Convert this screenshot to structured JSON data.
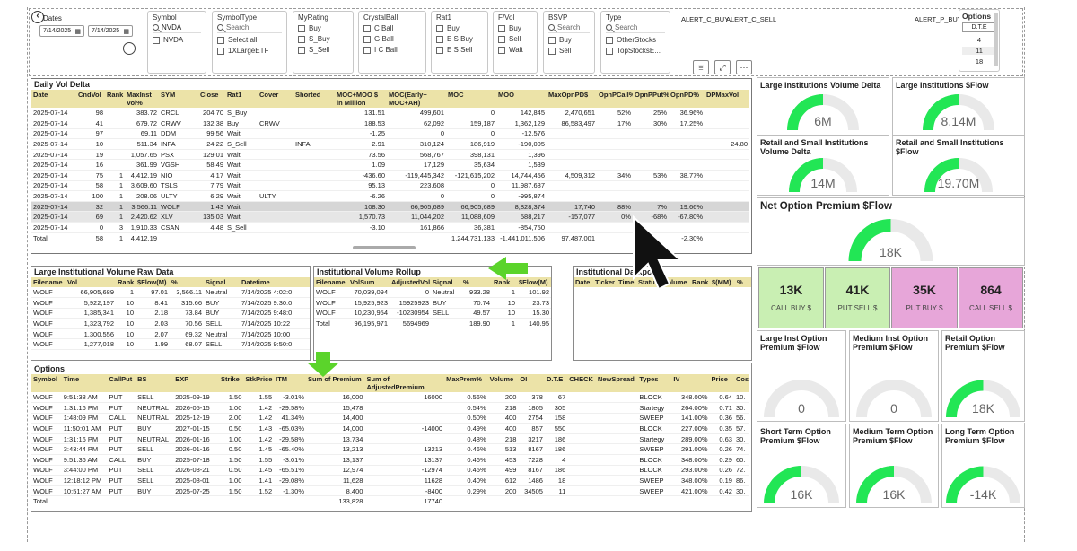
{
  "slicers": {
    "dates": {
      "title": "Dates",
      "start": "7/14/2025",
      "end": "7/14/2025"
    },
    "symbol": {
      "title": "Symbol",
      "search": "NVDA",
      "options": [
        "NVDA"
      ]
    },
    "symboltype": {
      "title": "SymbolType",
      "search": "Search",
      "options": [
        "Select all",
        "1XLargeETF"
      ]
    },
    "myrating": {
      "title": "MyRating",
      "options": [
        "Buy",
        "S_Buy",
        "S_Sell"
      ]
    },
    "crystalball": {
      "title": "CrystalBall",
      "options": [
        "C Ball",
        "G Ball",
        "I C Ball"
      ]
    },
    "rat1": {
      "title": "Rat1",
      "options": [
        "Buy",
        "E S Buy",
        "E S Sell"
      ]
    },
    "fvol": {
      "title": "F/Vol",
      "options": [
        "Buy",
        "Sell",
        "Wait"
      ]
    },
    "bsvp": {
      "title": "BSVP",
      "search": "Search",
      "options": [
        "Buy",
        "Sell"
      ]
    },
    "type": {
      "title": "Type",
      "search": "Search",
      "options": [
        "OtherStocks",
        "TopStocksE..."
      ]
    },
    "alerts": [
      "ALERT_C_BUY",
      "ALERT_C_SELL",
      "ALERT_P_BUY"
    ],
    "options": {
      "title": "Options",
      "header": "D.T.E",
      "values": [
        "4",
        "11",
        "18"
      ]
    }
  },
  "daily": {
    "title": "Daily Vol Delta",
    "columns": [
      "Date",
      "CndVol",
      "Rank",
      "MaxInst Vol%",
      "SYM",
      "Close",
      "Rat1",
      "Cover",
      "Shorted",
      "MOC+MOO $ in Million",
      "MOC(Early+ MOC+AH)",
      "MOC",
      "MOO",
      "MaxOpnPD$",
      "OpnPCall%",
      "OpnPPut%",
      "OpnPD%",
      "DPMaxVol"
    ],
    "rows": [
      [
        "2025-07-14",
        "98",
        "",
        "383.72",
        "CRCL",
        "204.70",
        "S_Buy",
        "",
        "",
        "131.51",
        "499,601",
        "0",
        "142,845",
        "2,470,651",
        "52%",
        "25%",
        "36.96%",
        ""
      ],
      [
        "2025-07-14",
        "41",
        "",
        "679.72",
        "CRWV",
        "132.38",
        "Buy",
        "CRWV",
        "",
        "188.53",
        "62,092",
        "159,187",
        "1,362,129",
        "86,583,497",
        "17%",
        "30%",
        "17.25%",
        ""
      ],
      [
        "2025-07-14",
        "97",
        "",
        "69.11",
        "DDM",
        "99.56",
        "Wait",
        "",
        "",
        "-1.25",
        "0",
        "0",
        "-12,576",
        "",
        "",
        "",
        "",
        ""
      ],
      [
        "2025-07-14",
        "10",
        "",
        "511.34",
        "INFA",
        "24.22",
        "S_Sell",
        "",
        "INFA",
        "2.91",
        "310,124",
        "186,919",
        "-190,005",
        "",
        "",
        "",
        "",
        "24.80"
      ],
      [
        "2025-07-14",
        "19",
        "",
        "1,057.65",
        "PSX",
        "129.01",
        "Wait",
        "",
        "",
        "73.56",
        "568,767",
        "398,131",
        "1,396",
        "",
        "",
        "",
        "",
        ""
      ],
      [
        "2025-07-14",
        "16",
        "",
        "361.99",
        "VGSH",
        "58.49",
        "Wait",
        "",
        "",
        "1.09",
        "17,129",
        "35,634",
        "1,539",
        "",
        "",
        "",
        "",
        ""
      ],
      [
        "2025-07-14",
        "75",
        "1",
        "4,412.19",
        "NIO",
        "4.17",
        "Wait",
        "",
        "",
        "-436.60",
        "-119,445,342",
        "-121,615,202",
        "14,744,456",
        "4,509,312",
        "34%",
        "53%",
        "38.77%",
        ""
      ],
      [
        "2025-07-14",
        "58",
        "1",
        "3,609.60",
        "TSLS",
        "7.79",
        "Wait",
        "",
        "",
        "95.13",
        "223,608",
        "0",
        "11,987,687",
        "",
        "",
        "",
        "",
        ""
      ],
      [
        "2025-07-14",
        "100",
        "1",
        "208.06",
        "ULTY",
        "6.29",
        "Wait",
        "ULTY",
        "",
        "-6.26",
        "0",
        "0",
        "-995,874",
        "",
        "",
        "",
        "",
        ""
      ],
      [
        "2025-07-14",
        "32",
        "1",
        "3,566.11",
        "WOLF",
        "1.43",
        "Wait",
        "",
        "",
        "108.30",
        "66,905,689",
        "66,905,689",
        "8,828,374",
        "17,740",
        "88%",
        "7%",
        "19.66%",
        ""
      ],
      [
        "2025-07-14",
        "69",
        "1",
        "2,420.62",
        "XLV",
        "135.03",
        "Wait",
        "",
        "",
        "1,570.73",
        "11,044,202",
        "11,088,609",
        "588,217",
        "-157,077",
        "0%",
        "-68%",
        "-67.80%",
        ""
      ],
      [
        "2025-07-14",
        "0",
        "3",
        "1,910.33",
        "CSAN",
        "4.48",
        "S_Sell",
        "",
        "",
        "-3.10",
        "161,866",
        "36,381",
        "-854,750",
        "",
        "",
        "",
        "",
        ""
      ]
    ],
    "total": [
      "Total",
      "58",
      "1",
      "4,412.19",
      "",
      "",
      "",
      "",
      "",
      "",
      "",
      "1,244,731,133",
      "-1,441,011,506",
      "97,487,001",
      "",
      "",
      "-2.30%",
      ""
    ]
  },
  "large_inst": {
    "title": "Large Institutional Volume Raw Data",
    "columns": [
      "Filename",
      "Vol",
      "Rank",
      "$Flow(M)",
      "%",
      "Signal",
      "Datetime"
    ],
    "rows": [
      [
        "WOLF",
        "66,905,689",
        "1",
        "97.01",
        "3,566.11",
        "Neutral",
        "7/14/2025 4:02:0"
      ],
      [
        "WOLF",
        "5,922,197",
        "10",
        "8.41",
        "315.66",
        "BUY",
        "7/14/2025 9:30:0"
      ],
      [
        "WOLF",
        "1,385,341",
        "10",
        "2.18",
        "73.84",
        "BUY",
        "7/14/2025 9:48:0"
      ],
      [
        "WOLF",
        "1,323,792",
        "10",
        "2.03",
        "70.56",
        "SELL",
        "7/14/2025 10:22"
      ],
      [
        "WOLF",
        "1,300,556",
        "10",
        "2.07",
        "69.32",
        "Neutral",
        "7/14/2025 10:00"
      ],
      [
        "WOLF",
        "1,277,018",
        "10",
        "1.99",
        "68.07",
        "SELL",
        "7/14/2025 9:50:0"
      ]
    ]
  },
  "rollup": {
    "title": "Institutional Volume Rollup",
    "columns": [
      "Filename",
      "VolSum",
      "AdjustedVol",
      "Signal",
      "%",
      "Rank",
      "$Flow(M)"
    ],
    "rows": [
      [
        "WOLF",
        "70,039,094",
        "0",
        "Neutral",
        "933.28",
        "1",
        "101.92"
      ],
      [
        "WOLF",
        "15,925,923",
        "15925923",
        "BUY",
        "70.74",
        "10",
        "23.73"
      ],
      [
        "WOLF",
        "10,230,954",
        "-10230954",
        "SELL",
        "49.57",
        "10",
        "15.30"
      ]
    ],
    "total": [
      "Total",
      "96,195,971",
      "5694969",
      "",
      "189.90",
      "1",
      "140.95"
    ]
  },
  "darkpool": {
    "title": "Institutional Darkpool",
    "columns": [
      "Date",
      "Ticker",
      "Time",
      "Status",
      "Volume",
      "Rank",
      "$(MM)",
      "%"
    ]
  },
  "options_table": {
    "title": "Options",
    "columns": [
      "Symbol",
      "Time",
      "CallPut",
      "BS",
      "EXP",
      "Strike",
      "StkPrice",
      "ITM",
      "Sum of Premium",
      "Sum of AdjustedPremium",
      "MaxPrem%",
      "Volume",
      "OI",
      "D.T.E",
      "CHECK",
      "NewSpread",
      "Types",
      "IV",
      "Price",
      "Cos"
    ],
    "rows": [
      [
        "WOLF",
        "9:51:38 AM",
        "PUT",
        "SELL",
        "2025-09-19",
        "1.50",
        "1.55",
        "-3.01%",
        "16,000",
        "16000",
        "0.56%",
        "200",
        "378",
        "67",
        "",
        "",
        "BLOCK",
        "348.00%",
        "0.64",
        "10."
      ],
      [
        "WOLF",
        "1:31:16 PM",
        "PUT",
        "NEUTRAL",
        "2026-05-15",
        "1.00",
        "1.42",
        "-29.58%",
        "15,478",
        "",
        "0.54%",
        "218",
        "1805",
        "305",
        "",
        "",
        "Startegy",
        "264.00%",
        "0.71",
        "30."
      ],
      [
        "WOLF",
        "1:48:09 PM",
        "CALL",
        "NEUTRAL",
        "2025-12-19",
        "2.00",
        "1.42",
        "41.34%",
        "14,400",
        "",
        "0.50%",
        "400",
        "2754",
        "158",
        "",
        "",
        "SWEEP",
        "141.00%",
        "0.36",
        "56."
      ],
      [
        "WOLF",
        "11:50:01 AM",
        "PUT",
        "BUY",
        "2027-01-15",
        "0.50",
        "1.43",
        "-65.03%",
        "14,000",
        "-14000",
        "0.49%",
        "400",
        "857",
        "550",
        "",
        "",
        "BLOCK",
        "227.00%",
        "0.35",
        "57."
      ],
      [
        "WOLF",
        "1:31:16 PM",
        "PUT",
        "NEUTRAL",
        "2026-01-16",
        "1.00",
        "1.42",
        "-29.58%",
        "13,734",
        "",
        "0.48%",
        "218",
        "3217",
        "186",
        "",
        "",
        "Startegy",
        "289.00%",
        "0.63",
        "30."
      ],
      [
        "WOLF",
        "3:43:44 PM",
        "PUT",
        "SELL",
        "2026-01-16",
        "0.50",
        "1.45",
        "-65.40%",
        "13,213",
        "13213",
        "0.46%",
        "513",
        "8167",
        "186",
        "",
        "",
        "SWEEP",
        "291.00%",
        "0.26",
        "74."
      ],
      [
        "WOLF",
        "9:51:36 AM",
        "CALL",
        "BUY",
        "2025-07-18",
        "1.50",
        "1.55",
        "-3.01%",
        "13,137",
        "13137",
        "0.46%",
        "453",
        "7228",
        "4",
        "",
        "",
        "BLOCK",
        "348.00%",
        "0.29",
        "60."
      ],
      [
        "WOLF",
        "3:44:00 PM",
        "PUT",
        "SELL",
        "2026-08-21",
        "0.50",
        "1.45",
        "-65.51%",
        "12,974",
        "-12974",
        "0.45%",
        "499",
        "8167",
        "186",
        "",
        "",
        "BLOCK",
        "293.00%",
        "0.26",
        "72."
      ],
      [
        "WOLF",
        "12:18:12 PM",
        "PUT",
        "SELL",
        "2025-08-01",
        "1.00",
        "1.41",
        "-29.08%",
        "11,628",
        "11628",
        "0.40%",
        "612",
        "1486",
        "18",
        "",
        "",
        "SWEEP",
        "348.00%",
        "0.19",
        "86."
      ],
      [
        "WOLF",
        "10:51:27 AM",
        "PUT",
        "BUY",
        "2025-07-25",
        "1.50",
        "1.52",
        "-1.30%",
        "8,400",
        "-8400",
        "0.29%",
        "200",
        "34505",
        "11",
        "",
        "",
        "SWEEP",
        "421.00%",
        "0.42",
        "30."
      ]
    ],
    "total": [
      "Total",
      "",
      "",
      "",
      "",
      "",
      "",
      "",
      "133,828",
      "17740",
      "",
      "",
      "",
      "",
      "",
      "",
      "",
      "",
      "",
      ""
    ]
  },
  "gauges": {
    "large_vol_delta": {
      "title": "Large Institutions Volume Delta",
      "value": "6M",
      "fraction": 0.5
    },
    "large_flow": {
      "title": "Large Institutions $Flow",
      "value": "8.14M",
      "fraction": 0.5
    },
    "retail_vol_delta": {
      "title": "Retail and Small Institutions Volume Delta",
      "value": "14M",
      "fraction": 0.5
    },
    "retail_flow": {
      "title": "Retail and Small Institutions $Flow",
      "value": "19.70M",
      "fraction": 0.5
    },
    "net_premium": {
      "title": "Net Option Premium $Flow",
      "value": "18K",
      "fraction": 0.5
    },
    "large_inst_premium": {
      "title": "Large Inst Option Premium $Flow",
      "value": "0",
      "fraction": 0
    },
    "medium_inst_premium": {
      "title": "Medium Inst Option Premium $Flow",
      "value": "0",
      "fraction": 0
    },
    "retail_premium": {
      "title": "Retail Option Premium $Flow",
      "value": "18K",
      "fraction": 0.5
    },
    "short_term_premium": {
      "title": "Short Term Option Premium $Flow",
      "value": "16K",
      "fraction": 0.5
    },
    "medium_term_premium": {
      "title": "Medium Term Option Premium $Flow",
      "value": "16K",
      "fraction": 0.5
    },
    "long_term_premium": {
      "title": "Long Term Option Premium $Flow",
      "value": "-14K",
      "fraction": 0.5
    }
  },
  "kpis": [
    {
      "value": "13K",
      "label": "CALL BUY $",
      "color": "#c9efb3"
    },
    {
      "value": "41K",
      "label": "PUT SELL $",
      "color": "#c9efb3"
    },
    {
      "value": "35K",
      "label": "PUT BUY $",
      "color": "#e7a6d9"
    },
    {
      "value": "864",
      "label": "CALL SELL $",
      "color": "#e7a6d9"
    }
  ],
  "colors": {
    "gauge_fill": "#22e655",
    "gauge_track": "#e9e9e9",
    "header": "#ece3a8",
    "arrow": "#5bd42b"
  },
  "icons": [
    "filter-icon",
    "focus-mode-icon",
    "more-options-icon",
    "back-arrow-icon",
    "calendar-icon"
  ]
}
